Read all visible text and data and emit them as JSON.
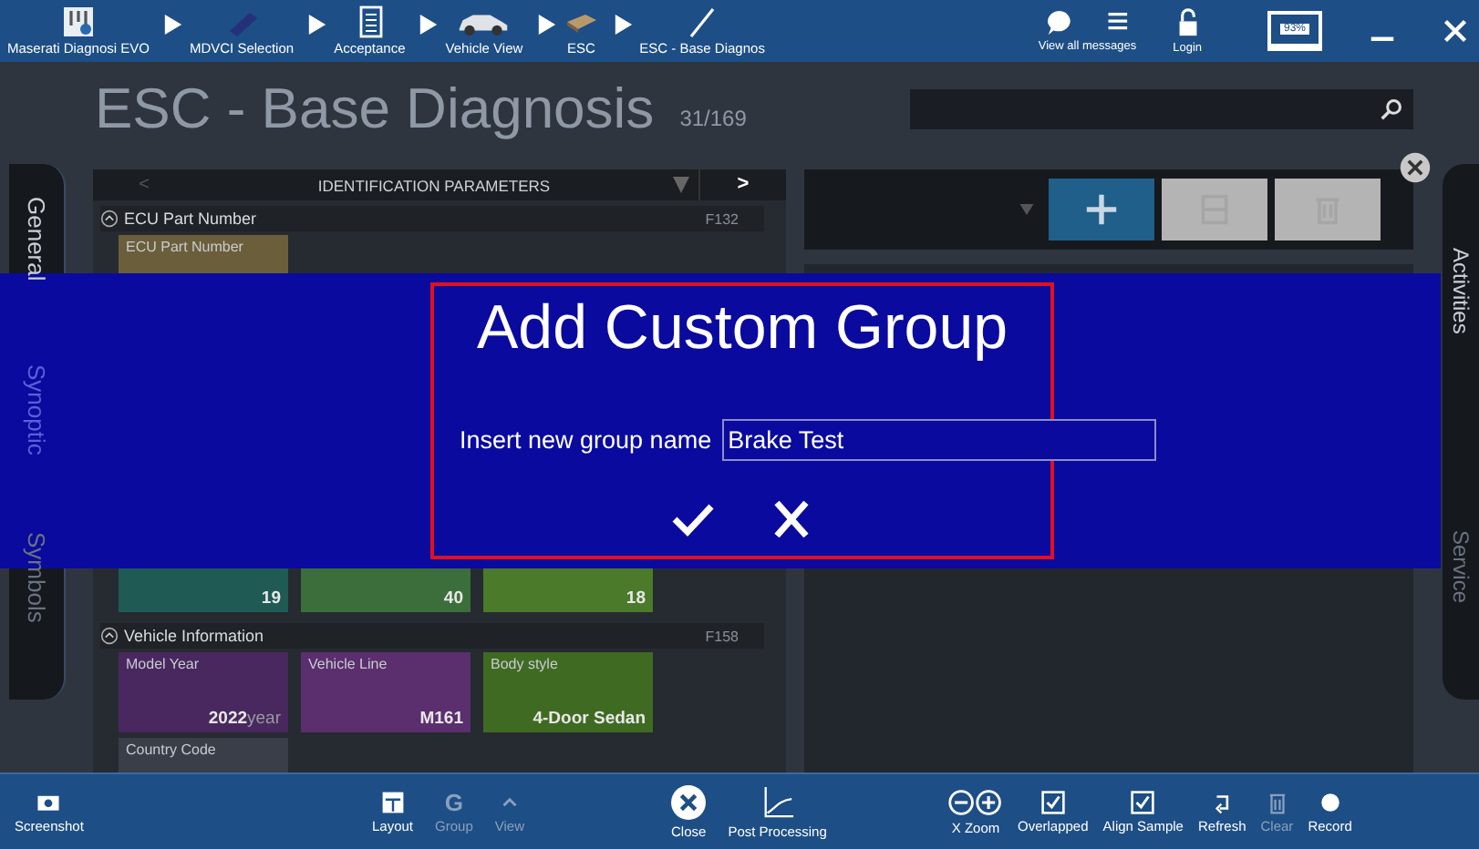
{
  "breadcrumbs": [
    {
      "label": "Maserati Diagnosi EVO",
      "kind": "logo"
    },
    {
      "label": "MDVCI Selection",
      "kind": "device"
    },
    {
      "label": "Acceptance",
      "kind": "document"
    },
    {
      "label": "Vehicle View",
      "kind": "car"
    },
    {
      "label": "ESC",
      "kind": "module"
    },
    {
      "label": "ESC - Base Diagnos",
      "kind": "probe"
    }
  ],
  "top_actions": [
    {
      "kind": "messages",
      "label": "View all messages"
    },
    {
      "kind": "login",
      "label": "Login"
    }
  ],
  "battery": {
    "reading": "93%"
  },
  "title": "ESC - Base Diagnosis",
  "counter": "31/169",
  "left_tabs": [
    {
      "label": "General",
      "selected": true
    },
    {
      "label": "Synoptic",
      "selected": false
    },
    {
      "label": "Symbols",
      "selected": false
    }
  ],
  "right_tabs": [
    {
      "label": "Activities",
      "selected": true
    },
    {
      "label": "Service",
      "selected": false
    }
  ],
  "parameters": {
    "prev": "<",
    "header": "IDENTIFICATION PARAMETERS",
    "next": ">",
    "groups": [
      {
        "name": "ECU Part Number",
        "code": "F132",
        "expanded": true,
        "rows": [
          [
            {
              "label": "ECU Part Number",
              "color": "#6b5e3b"
            }
          ],
          [
            {
              "value": "19",
              "color": "#1f5a55"
            },
            {
              "value": "40",
              "color": "#3b6e3b"
            },
            {
              "value": "18",
              "color": "#4a7a2a"
            }
          ]
        ]
      },
      {
        "name": "Vehicle Information",
        "code": "F158",
        "expanded": true,
        "rows": [
          [
            {
              "label": "Model Year",
              "value": "2022",
              "unit": "year",
              "color": "#48285e"
            },
            {
              "label": "Vehicle Line",
              "value": "M161",
              "color": "#5b2e6e"
            },
            {
              "label": "Body style",
              "value": "4-Door Sedan",
              "color": "#3f6a22"
            }
          ],
          [
            {
              "label": "Country Code",
              "color": "#3a3e48"
            }
          ]
        ]
      }
    ]
  },
  "group_buttons": [
    {
      "kind": "add",
      "disabled": false
    },
    {
      "kind": "save",
      "disabled": true
    },
    {
      "kind": "delete",
      "disabled": true
    }
  ],
  "dialog": {
    "title": "Add Custom Group",
    "label": "Insert new group name",
    "value": "Brake Test",
    "buttons": [
      {
        "kind": "confirm"
      },
      {
        "kind": "cancel"
      }
    ]
  },
  "toolbar": [
    {
      "items": [
        {
          "kind": "camera",
          "label": "Screenshot",
          "disabled": false
        }
      ]
    },
    {
      "items": [
        {
          "kind": "layout",
          "label": "Layout",
          "disabled": false
        },
        {
          "kind": "glyph",
          "glyph": "G",
          "label": "Group",
          "disabled": true
        },
        {
          "kind": "caret",
          "label": "View",
          "disabled": true
        }
      ]
    },
    {
      "items": [
        {
          "kind": "close",
          "label": "Close",
          "disabled": false
        },
        {
          "kind": "chart",
          "label": "Post Processing",
          "disabled": false
        }
      ]
    },
    {
      "items": [
        {
          "kind": "zoom",
          "prefix": "X",
          "label": "Zoom",
          "disabled": false
        },
        {
          "kind": "checkbox",
          "label": "Overlapped",
          "checked": true,
          "disabled": false
        },
        {
          "kind": "checkbox",
          "label": "Align Sample",
          "checked": true,
          "disabled": false
        },
        {
          "kind": "refresh",
          "label": "Refresh",
          "disabled": false
        },
        {
          "kind": "trash",
          "label": "Clear",
          "disabled": true
        },
        {
          "kind": "record",
          "label": "Record",
          "disabled": false
        }
      ]
    }
  ]
}
